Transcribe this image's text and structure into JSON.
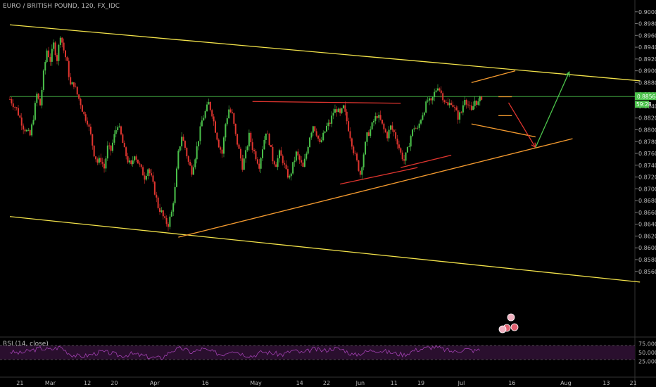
{
  "chart_data": {
    "type": "candlestick",
    "title": "EURO / BRITISH POUND, 120, FX_IDC",
    "indicator_title": "RSI (14, close)",
    "price_axis": {
      "ylim": [
        0.845,
        0.902
      ],
      "ticks": [
        "0.90000",
        "0.89800",
        "0.89600",
        "0.89400",
        "0.89200",
        "0.89000",
        "0.88800",
        "0.88600",
        "0.88400",
        "0.88200",
        "0.88000",
        "0.87800",
        "0.87600",
        "0.87400",
        "0.87200",
        "0.87000",
        "0.86800",
        "0.86600",
        "0.86400",
        "0.86200",
        "0.86000",
        "0.85800",
        "0.85600"
      ],
      "current_price_label": "0.88564",
      "countdown_label": "59:28"
    },
    "rsi_axis": {
      "ticks": [
        "75.0000",
        "50.0000",
        "25.0000"
      ],
      "bands": [
        70,
        30
      ]
    },
    "x_axis": {
      "ticks": [
        {
          "label": "21",
          "day": -9
        },
        {
          "label": "Mar",
          "day": 0
        },
        {
          "label": "12",
          "day": 11
        },
        {
          "label": "20",
          "day": 19
        },
        {
          "label": "Apr",
          "day": 31
        },
        {
          "label": "16",
          "day": 46
        },
        {
          "label": "May",
          "day": 61
        },
        {
          "label": "14",
          "day": 74
        },
        {
          "label": "22",
          "day": 82
        },
        {
          "label": "Jun",
          "day": 92
        },
        {
          "label": "11",
          "day": 102
        },
        {
          "label": "19",
          "day": 110
        },
        {
          "label": "Jul",
          "day": 122
        },
        {
          "label": "16",
          "day": 137
        },
        {
          "label": "Aug",
          "day": 153
        },
        {
          "label": "13",
          "day": 165
        },
        {
          "label": "21",
          "day": 173
        }
      ]
    },
    "price_path": [
      [
        -12,
        0.8852
      ],
      [
        -10,
        0.8835
      ],
      [
        -8,
        0.8805
      ],
      [
        -6,
        0.879
      ],
      [
        -5,
        0.8822
      ],
      [
        -4,
        0.886
      ],
      [
        -3,
        0.8842
      ],
      [
        -2,
        0.8895
      ],
      [
        -1,
        0.8935
      ],
      [
        0,
        0.8918
      ],
      [
        1,
        0.8945
      ],
      [
        2,
        0.892
      ],
      [
        3,
        0.8962
      ],
      [
        4,
        0.8935
      ],
      [
        5,
        0.8912
      ],
      [
        6,
        0.8875
      ],
      [
        7,
        0.8878
      ],
      [
        8,
        0.886
      ],
      [
        9,
        0.8845
      ],
      [
        10,
        0.8825
      ],
      [
        11,
        0.8815
      ],
      [
        12,
        0.879
      ],
      [
        13,
        0.876
      ],
      [
        14,
        0.8745
      ],
      [
        15,
        0.875
      ],
      [
        16,
        0.8735
      ],
      [
        17,
        0.877
      ],
      [
        18,
        0.8765
      ],
      [
        19,
        0.879
      ],
      [
        20,
        0.881
      ],
      [
        21,
        0.879
      ],
      [
        22,
        0.8765
      ],
      [
        23,
        0.8748
      ],
      [
        24,
        0.8738
      ],
      [
        25,
        0.876
      ],
      [
        26,
        0.8745
      ],
      [
        27,
        0.8732
      ],
      [
        28,
        0.872
      ],
      [
        29,
        0.8735
      ],
      [
        30,
        0.8718
      ],
      [
        31,
        0.8695
      ],
      [
        32,
        0.867
      ],
      [
        33,
        0.866
      ],
      [
        34,
        0.8645
      ],
      [
        35,
        0.864
      ],
      [
        36,
        0.866
      ],
      [
        37,
        0.87
      ],
      [
        38,
        0.876
      ],
      [
        39,
        0.879
      ],
      [
        40,
        0.877
      ],
      [
        41,
        0.8745
      ],
      [
        42,
        0.873
      ],
      [
        43,
        0.8755
      ],
      [
        44,
        0.8785
      ],
      [
        45,
        0.8815
      ],
      [
        46,
        0.883
      ],
      [
        47,
        0.8845
      ],
      [
        48,
        0.8828
      ],
      [
        49,
        0.88
      ],
      [
        50,
        0.8775
      ],
      [
        51,
        0.876
      ],
      [
        52,
        0.881
      ],
      [
        53,
        0.8835
      ],
      [
        54,
        0.8825
      ],
      [
        55,
        0.879
      ],
      [
        56,
        0.8765
      ],
      [
        57,
        0.8738
      ],
      [
        58,
        0.876
      ],
      [
        59,
        0.879
      ],
      [
        60,
        0.877
      ],
      [
        61,
        0.8755
      ],
      [
        62,
        0.874
      ],
      [
        63,
        0.877
      ],
      [
        64,
        0.8798
      ],
      [
        65,
        0.878
      ],
      [
        66,
        0.875
      ],
      [
        67,
        0.8742
      ],
      [
        68,
        0.876
      ],
      [
        69,
        0.8748
      ],
      [
        70,
        0.8728
      ],
      [
        71,
        0.8718
      ],
      [
        72,
        0.874
      ],
      [
        73,
        0.876
      ],
      [
        74,
        0.8748
      ],
      [
        75,
        0.8735
      ],
      [
        76,
        0.876
      ],
      [
        77,
        0.879
      ],
      [
        78,
        0.8808
      ],
      [
        79,
        0.8795
      ],
      [
        80,
        0.8775
      ],
      [
        81,
        0.879
      ],
      [
        82,
        0.8805
      ],
      [
        83,
        0.8812
      ],
      [
        84,
        0.883
      ],
      [
        85,
        0.8835
      ],
      [
        86,
        0.8825
      ],
      [
        87,
        0.8838
      ],
      [
        88,
        0.8815
      ],
      [
        89,
        0.879
      ],
      [
        90,
        0.8765
      ],
      [
        91,
        0.8745
      ],
      [
        92,
        0.8725
      ],
      [
        93,
        0.876
      ],
      [
        94,
        0.879
      ],
      [
        95,
        0.88
      ],
      [
        96,
        0.8815
      ],
      [
        97,
        0.8825
      ],
      [
        98,
        0.8815
      ],
      [
        99,
        0.88
      ],
      [
        100,
        0.879
      ],
      [
        101,
        0.8805
      ],
      [
        102,
        0.8795
      ],
      [
        103,
        0.878
      ],
      [
        104,
        0.876
      ],
      [
        105,
        0.8748
      ],
      [
        106,
        0.8765
      ],
      [
        107,
        0.879
      ],
      [
        108,
        0.8805
      ],
      [
        109,
        0.88
      ],
      [
        110,
        0.882
      ],
      [
        111,
        0.8835
      ],
      [
        112,
        0.885
      ],
      [
        113,
        0.8845
      ],
      [
        114,
        0.8862
      ],
      [
        115,
        0.8875
      ],
      [
        116,
        0.8862
      ],
      [
        117,
        0.885
      ],
      [
        118,
        0.884
      ],
      [
        119,
        0.8848
      ],
      [
        120,
        0.8835
      ],
      [
        121,
        0.8822
      ],
      [
        122,
        0.883
      ],
      [
        123,
        0.8855
      ],
      [
        124,
        0.8842
      ],
      [
        125,
        0.883
      ],
      [
        126,
        0.885
      ],
      [
        127,
        0.8845
      ],
      [
        128,
        0.8856
      ]
    ],
    "rsi_path": [
      [
        -12,
        52
      ],
      [
        -9,
        48
      ],
      [
        -6,
        55
      ],
      [
        -3,
        62
      ],
      [
        0,
        58
      ],
      [
        3,
        66
      ],
      [
        6,
        45
      ],
      [
        9,
        38
      ],
      [
        12,
        44
      ],
      [
        15,
        52
      ],
      [
        18,
        48
      ],
      [
        21,
        40
      ],
      [
        24,
        46
      ],
      [
        27,
        42
      ],
      [
        30,
        36
      ],
      [
        33,
        34
      ],
      [
        36,
        55
      ],
      [
        39,
        62
      ],
      [
        42,
        50
      ],
      [
        45,
        60
      ],
      [
        48,
        52
      ],
      [
        51,
        44
      ],
      [
        54,
        58
      ],
      [
        57,
        46
      ],
      [
        60,
        40
      ],
      [
        63,
        52
      ],
      [
        66,
        48
      ],
      [
        69,
        44
      ],
      [
        72,
        56
      ],
      [
        75,
        48
      ],
      [
        78,
        60
      ],
      [
        81,
        55
      ],
      [
        84,
        62
      ],
      [
        87,
        58
      ],
      [
        90,
        42
      ],
      [
        93,
        50
      ],
      [
        96,
        58
      ],
      [
        99,
        54
      ],
      [
        102,
        48
      ],
      [
        105,
        44
      ],
      [
        108,
        56
      ],
      [
        111,
        62
      ],
      [
        114,
        66
      ],
      [
        117,
        58
      ],
      [
        120,
        52
      ],
      [
        123,
        60
      ],
      [
        126,
        55
      ],
      [
        128,
        59
      ]
    ],
    "drawings": {
      "channel_top": {
        "color": "#f2e24a",
        "points": [
          [
            -12,
            0.8978
          ],
          [
            175,
            0.8883
          ]
        ]
      },
      "channel_bottom": {
        "color": "#f2e24a",
        "points": [
          [
            -12,
            0.8653
          ],
          [
            175,
            0.8542
          ]
        ]
      },
      "rising_support": {
        "color": "#f59b2f",
        "points": [
          [
            38,
            0.8618
          ],
          [
            155,
            0.8785
          ]
        ]
      },
      "resistance_may": {
        "color": "#e0352f",
        "points": [
          [
            60,
            0.8848
          ],
          [
            104,
            0.8845
          ]
        ]
      },
      "support_june": {
        "color": "#e0352f",
        "points": [
          [
            86,
            0.8708
          ],
          [
            109,
            0.8736
          ]
        ]
      },
      "support_june_2": {
        "color": "#e0352f",
        "points": [
          [
            104,
            0.8736
          ],
          [
            119,
            0.8757
          ]
        ]
      },
      "pennant_upper": {
        "color": "#f59b2f",
        "points": [
          [
            125,
            0.888
          ],
          [
            138,
            0.89
          ]
        ]
      },
      "pennant_lower": {
        "color": "#f59b2f",
        "points": [
          [
            125,
            0.881
          ],
          [
            144,
            0.8788
          ]
        ]
      },
      "flag_upper": {
        "color": "#f59b2f",
        "points": [
          [
            133,
            0.8856
          ],
          [
            137,
            0.8856
          ]
        ]
      },
      "flag_lower": {
        "color": "#f59b2f",
        "points": [
          [
            133,
            0.8824
          ],
          [
            137,
            0.8824
          ]
        ]
      },
      "projection_down": {
        "color": "#e0352f",
        "points": [
          [
            136,
            0.8846
          ],
          [
            144,
            0.877
          ]
        ]
      },
      "projection_up": {
        "color": "#4bc24b",
        "points": [
          [
            144,
            0.877
          ],
          [
            154,
            0.8898
          ]
        ]
      },
      "current_price_line": {
        "color": "#4bc24b",
        "points": [
          [
            -12,
            0.88564
          ],
          [
            175,
            0.88564
          ]
        ]
      }
    }
  }
}
